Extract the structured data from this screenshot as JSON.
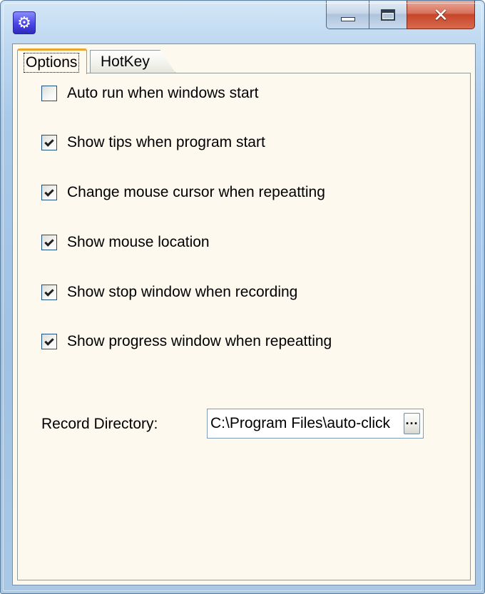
{
  "window": {
    "app_icon": "gear-icon",
    "caption_buttons": {
      "minimize_icon": "minimize-icon",
      "maximize_icon": "maximize-icon",
      "close_glyph": "✕"
    }
  },
  "tabs": [
    {
      "label": "Options",
      "active": true
    },
    {
      "label": "HotKey",
      "active": false
    }
  ],
  "options": [
    {
      "label": "Auto run when windows start",
      "checked": false
    },
    {
      "label": "Show tips when program start",
      "checked": true
    },
    {
      "label": "Change mouse cursor when repeatting",
      "checked": true
    },
    {
      "label": "Show mouse location",
      "checked": true
    },
    {
      "label": "Show stop window when recording",
      "checked": true
    },
    {
      "label": "Show progress window when repeatting",
      "checked": true
    }
  ],
  "record_directory": {
    "label": "Record Directory:",
    "value": "C:\\Program Files\\auto-click",
    "browse_label": "···"
  },
  "colors": {
    "client_background": "#fdf9ef",
    "active_tab_accent": "#e8a72f",
    "close_button": "#c7452a"
  }
}
